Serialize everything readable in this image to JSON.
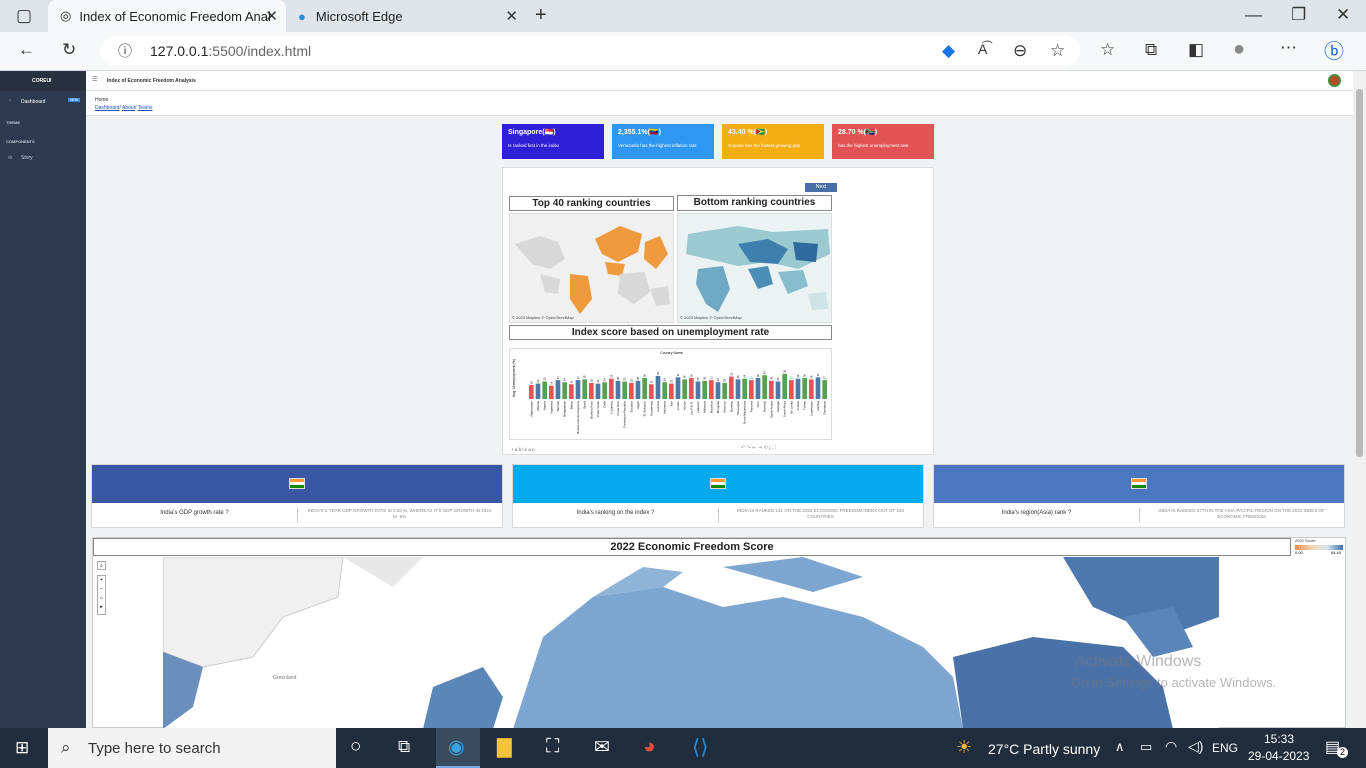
{
  "browser": {
    "tabs": [
      {
        "label": "Index of Economic Freedom Anal"
      },
      {
        "label": "Microsoft Edge"
      }
    ],
    "url_host": "127.0.0.1",
    "url_path": ":5500/index.html"
  },
  "sidebar": {
    "brand": "COREUI",
    "items": [
      {
        "label": "Dashboard",
        "badge": "NEW"
      },
      {
        "label": "THEME"
      },
      {
        "label": "COMPONENTS"
      },
      {
        "label": "Story"
      }
    ]
  },
  "header": {
    "title": "Index of Economic Freedom Analysis",
    "breadcrumb_home": "Home",
    "links": [
      "Dashboard",
      "About",
      "Teams"
    ]
  },
  "kpis": [
    {
      "value": "Singapore(🇸🇬)",
      "desc": "Is ranked first in the index",
      "color": "#2f1fd6"
    },
    {
      "value": "2,355.1%(🇻🇪)",
      "desc": "Venezuela has the highest inflation rate",
      "color": "#2f97f2"
    },
    {
      "value": "43.40 %(🇬🇾)",
      "desc": "Guyana has the fastest growing gdp",
      "color": "#f4ad12"
    },
    {
      "value": "28.70 %(🇿🇦)",
      "desc": "has the highest unemployment rate",
      "color": "#e25454"
    }
  ],
  "story": {
    "next_label": "Next",
    "top_title": "Top 40 ranking countries",
    "bottom_title": "Bottom ranking countries",
    "chart_title": "Index score based on unemployment rate",
    "map_credit": "© 2023 Mapbox © OpenStreetMap",
    "tableau": "+ a b l e a u"
  },
  "chart_data": {
    "type": "bar",
    "title": "Index score based on unemployment rate",
    "xlabel": "Country Name",
    "ylabel": "Avg. Unemployment (%)",
    "ylim": [
      0,
      60
    ],
    "categories": [
      "Afghanistan",
      "Albania",
      "Algeria",
      "Argentina",
      "Bahrain",
      "Bangladesh",
      "Belize",
      "Bosnia and Herzegovina",
      "Brazil",
      "Burkina Faso",
      "Cabo Verde",
      "Chile",
      "Colombia",
      "Costa Rica",
      "Dominican Republic",
      "Ecuador",
      "Egypt",
      "El Salvador",
      "Guatemala",
      "Guyana",
      "Indonesia",
      "Iran",
      "Jordan",
      "Kenya",
      "Lao P.D.R.",
      "Lebanon",
      "Malaysia",
      "Mauritius",
      "Mongolia",
      "Morocco",
      "Namibia",
      "Nicaragua",
      "North Macedonia",
      "Panama",
      "Peru",
      "Rwanda",
      "Saudi Arabia",
      "Senegal",
      "South Africa",
      "Sri Lanka",
      "Tunisia",
      "Turkey",
      "Uzbekistan",
      "Zambia",
      "Zimbabwe"
    ],
    "values": [
      20,
      22,
      25,
      19,
      27,
      24,
      21,
      27,
      28,
      23,
      22,
      24,
      29,
      26,
      25,
      23,
      26,
      30,
      21,
      33,
      24,
      22,
      31,
      28,
      30,
      25,
      26,
      27,
      24,
      23,
      32,
      28,
      29,
      27,
      30,
      34,
      26,
      25,
      36,
      27,
      29,
      30,
      28,
      31,
      27
    ],
    "colors": [
      "#e15759",
      "#4e79a7",
      "#59a14f"
    ],
    "grid": false
  },
  "cards": [
    {
      "question": "India's GDP growth rate ?",
      "answer": "INDIA'S 5 YEAR GDP GROWTH RATE IS 3.50 %, WHEREAS IT'S GDP GROWTH IN 2022 IS -6%",
      "color": "#3b57a3"
    },
    {
      "question": "India's ranking on the index ?",
      "answer": "INDIA IS RANKED 131 ON THE 2022 ECONOMIC FREEDOM INDEX OUT OF 184 COUNTRIES",
      "color": "#05aaee"
    },
    {
      "question": "India's region(Asia) rank ?",
      "answer": "INDIA IS RANKED 27TH IN THE ASIA-PACIFIC REGION ON THE 2022 INDEX OF ECONOMIC FREEDOM",
      "color": "#4a77bf"
    }
  ],
  "bigmap": {
    "title": "2022 Economic Freedom Score",
    "legend_title": "2022 Score",
    "legend_min": "0.00",
    "legend_max": "84.40",
    "label_greenland": "Greenland"
  },
  "watermark": {
    "line1": "Activate Windows",
    "line2": "Go to Settings to activate Windows."
  },
  "taskbar": {
    "search_placeholder": "Type here to search",
    "weather": "27°C  Partly sunny",
    "lang": "ENG",
    "time": "15:33",
    "date": "29-04-2023",
    "notifications": "2"
  }
}
